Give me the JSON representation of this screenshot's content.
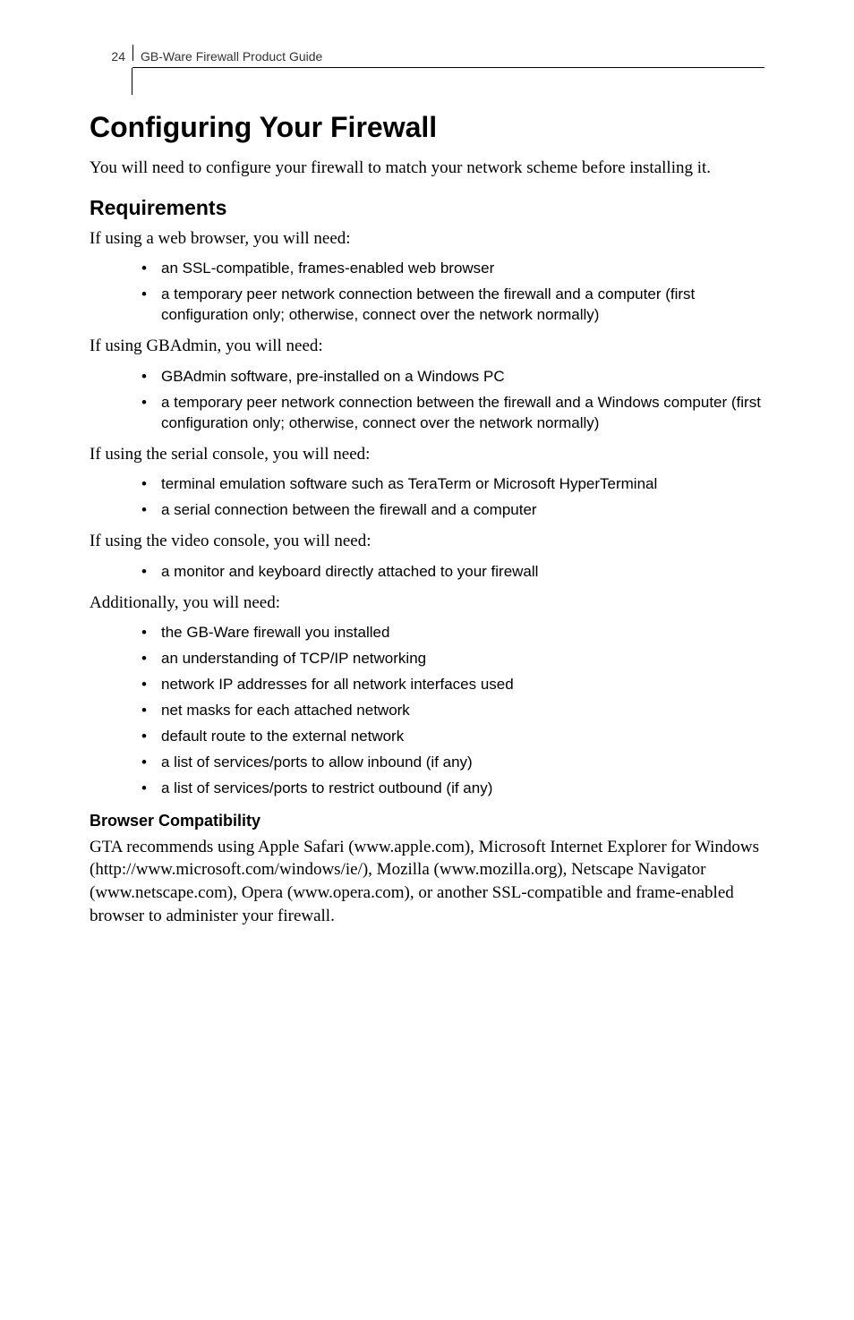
{
  "header": {
    "page_number": "24",
    "running_title": "GB-Ware Firewall Product Guide"
  },
  "h1": "Configuring Your Firewall",
  "intro": "You will need to configure your firewall to match your network scheme before installing it.",
  "requirements": {
    "heading": "Requirements",
    "web_intro": "If using a web browser, you will need:",
    "web_items": [
      "an SSL-compatible, frames-enabled web browser",
      "a temporary peer network connection between the firewall and a computer (first configuration only; otherwise, connect over the network normally)"
    ],
    "gbadmin_intro": "If using GBAdmin, you will need:",
    "gbadmin_items": [
      "GBAdmin software, pre-installed on a Windows PC",
      "a temporary peer network connection between the firewall and a Windows computer (first configuration only; otherwise, connect over the network normally)"
    ],
    "serial_intro": "If using the serial console, you will need:",
    "serial_items": [
      "terminal emulation software such as TeraTerm or Microsoft HyperTerminal",
      "a serial connection between the firewall and a computer"
    ],
    "video_intro": "If using the video console, you will need:",
    "video_items": [
      "a monitor and keyboard directly attached to your firewall"
    ],
    "additional_intro": "Additionally, you will need:",
    "additional_items": [
      "the GB-Ware firewall you installed",
      "an understanding of TCP/IP networking",
      "network IP addresses for all network interfaces used",
      "net masks for each attached network",
      "default route to the external network",
      "a list of services/ports to allow inbound (if any)",
      "a list of services/ports to restrict outbound (if any)"
    ]
  },
  "browser_compat": {
    "heading": "Browser Compatibility",
    "body": "GTA recommends using Apple Safari (www.apple.com), Microsoft Internet Explorer for Windows (http://www.microsoft.com/windows/ie/), Mozilla (www.mozilla.org), Netscape Navigator (www.netscape.com), Opera (www.opera.com), or another SSL-compatible and frame-enabled browser  to administer your firewall."
  }
}
